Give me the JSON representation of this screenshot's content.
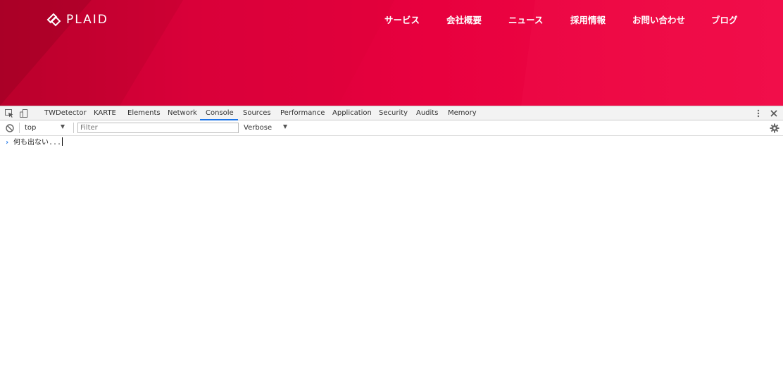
{
  "site": {
    "logo_text": "PLAID",
    "brand_color": "#e8003e",
    "nav": [
      {
        "label": "サービス"
      },
      {
        "label": "会社概要"
      },
      {
        "label": "ニュース"
      },
      {
        "label": "採用情報"
      },
      {
        "label": "お問い合わせ"
      },
      {
        "label": "ブログ"
      }
    ]
  },
  "devtools": {
    "icons": {
      "inspect": "inspect-element-icon",
      "device": "device-toolbar-icon",
      "menu": "kebab-menu-icon",
      "close": "close-icon",
      "clear": "clear-console-icon",
      "settings": "gear-icon"
    },
    "tabs": [
      {
        "label": "TWDetector",
        "active": false
      },
      {
        "label": "KARTE",
        "active": false
      },
      {
        "label": "Elements",
        "active": false
      },
      {
        "label": "Network",
        "active": false
      },
      {
        "label": "Console",
        "active": true
      },
      {
        "label": "Sources",
        "active": false
      },
      {
        "label": "Performance",
        "active": false
      },
      {
        "label": "Application",
        "active": false
      },
      {
        "label": "Security",
        "active": false
      },
      {
        "label": "Audits",
        "active": false
      },
      {
        "label": "Memory",
        "active": false
      }
    ],
    "toolbar": {
      "context": "top",
      "filter_placeholder": "Filter",
      "filter_value": "",
      "level": "Verbose"
    },
    "console": {
      "prompt_symbol": "›",
      "input": "何も出ない..."
    },
    "accent_color": "#1a73e8"
  }
}
